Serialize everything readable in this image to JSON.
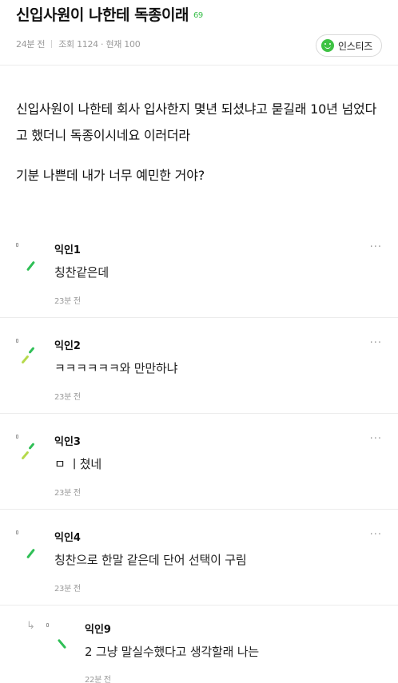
{
  "post": {
    "title": "신입사원이 나한테 독종이래",
    "comment_count": "69",
    "time_ago": "24분 전",
    "views": "조회 1124 · 현재 100",
    "board": "인스티즈",
    "body": [
      "신입사원이 나한테 회사 입사한지 몇년 되셨냐고 묻길래 10년 넘었다고 했더니 독종이시네요 이러더라",
      "기분 나쁜데 내가 너무 예민한 거야?"
    ]
  },
  "comments": [
    {
      "author": "익인1",
      "text": "칭찬같은데",
      "time": "23분 전",
      "more": "···"
    },
    {
      "author": "익인2",
      "text": "ㅋㅋㅋㅋㅋㅋ와 만만하냐",
      "time": "23분 전",
      "more": "···"
    },
    {
      "author": "익인3",
      "text": "ㅁ ㅣ쳤네",
      "time": "23분 전",
      "more": "···"
    },
    {
      "author": "익인4",
      "text": "칭찬으로 한말 같은데 단어 선택이 구림",
      "time": "23분 전",
      "more": "···"
    },
    {
      "author": "익인9",
      "text": "2 그냥 말실수했다고 생각할래 나는",
      "time": "22분 전",
      "more": "",
      "is_reply": true,
      "reply_icon": "↳"
    }
  ],
  "colors": {
    "accent": "#3ec243",
    "avatar_green": "#2fbf56",
    "avatar_lime": "#b5d94a"
  },
  "icons": {
    "board_icon": "smile-icon",
    "reply_icon": "reply-arrow-icon",
    "more_icon": "more-options-icon"
  }
}
